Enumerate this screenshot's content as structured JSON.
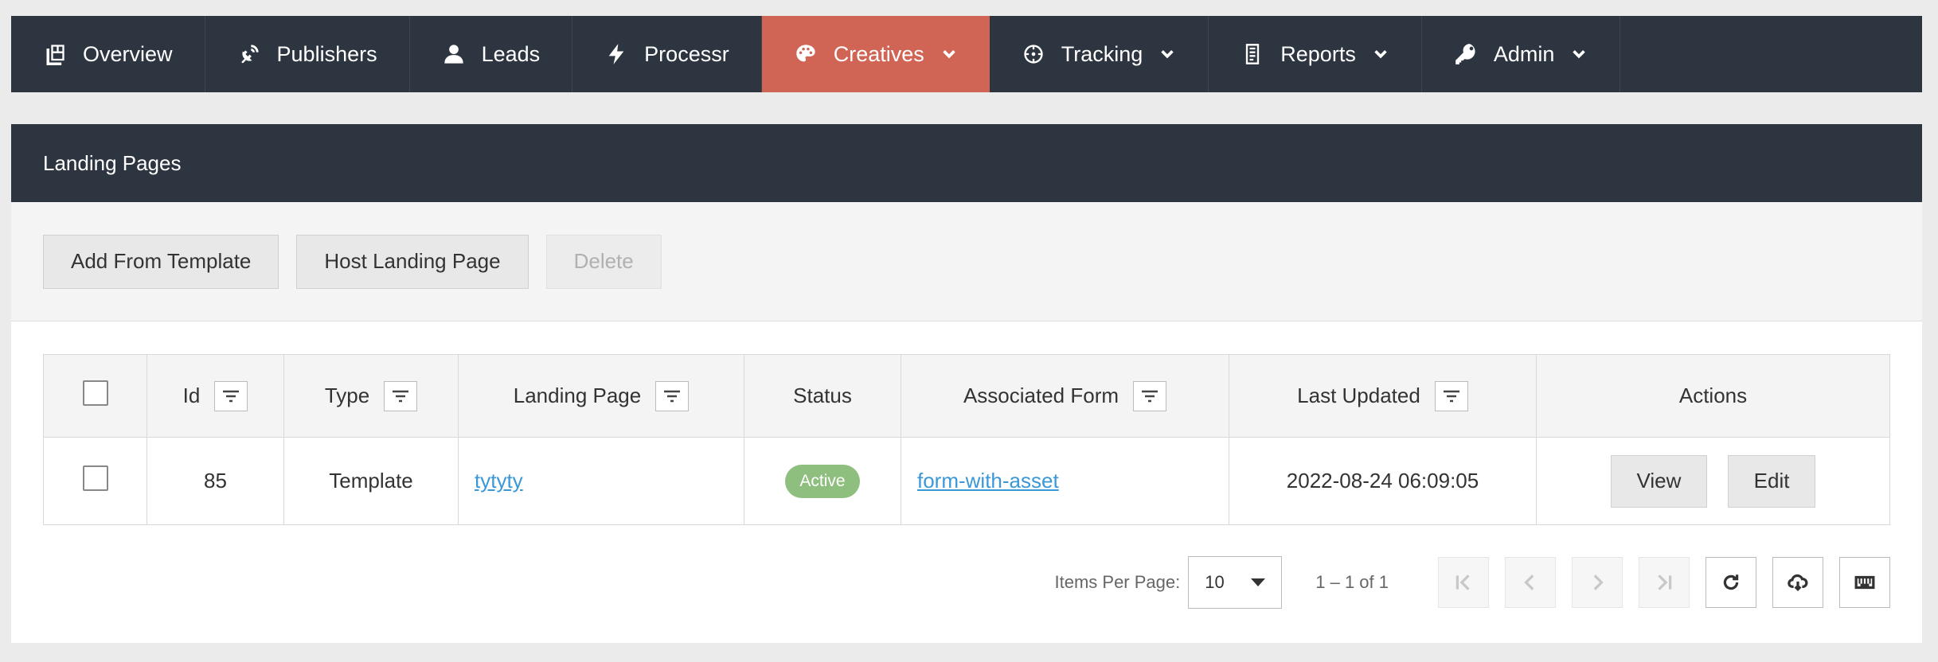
{
  "nav": {
    "items": [
      {
        "label": "Overview",
        "icon": "dashboard-icon",
        "dropdown": false,
        "active": false
      },
      {
        "label": "Publishers",
        "icon": "satellite-dish-icon",
        "dropdown": false,
        "active": false
      },
      {
        "label": "Leads",
        "icon": "user-icon",
        "dropdown": false,
        "active": false
      },
      {
        "label": "Processr",
        "icon": "bolt-icon",
        "dropdown": false,
        "active": false
      },
      {
        "label": "Creatives",
        "icon": "palette-icon",
        "dropdown": true,
        "active": true
      },
      {
        "label": "Tracking",
        "icon": "crosshairs-icon",
        "dropdown": true,
        "active": false
      },
      {
        "label": "Reports",
        "icon": "report-icon",
        "dropdown": true,
        "active": false
      },
      {
        "label": "Admin",
        "icon": "key-icon",
        "dropdown": true,
        "active": false
      }
    ],
    "active_color": "#d06556",
    "bg_color": "#2d3540"
  },
  "panel": {
    "title": "Landing Pages"
  },
  "toolbar": {
    "add_template": "Add From Template",
    "host_landing": "Host Landing Page",
    "delete": "Delete"
  },
  "table": {
    "headers": {
      "id": "Id",
      "type": "Type",
      "landing_page": "Landing Page",
      "status": "Status",
      "associated_form": "Associated Form",
      "last_updated": "Last Updated",
      "actions": "Actions"
    },
    "rows": [
      {
        "id": "85",
        "type": "Template",
        "landing_page": "tytyty",
        "status": "Active",
        "associated_form": "form-with-asset",
        "last_updated": "2022-08-24 06:09:05",
        "view": "View",
        "edit": "Edit"
      }
    ]
  },
  "paginator": {
    "items_per_page_label": "Items Per Page:",
    "items_per_page": "10",
    "range": "1 – 1 of 1"
  }
}
